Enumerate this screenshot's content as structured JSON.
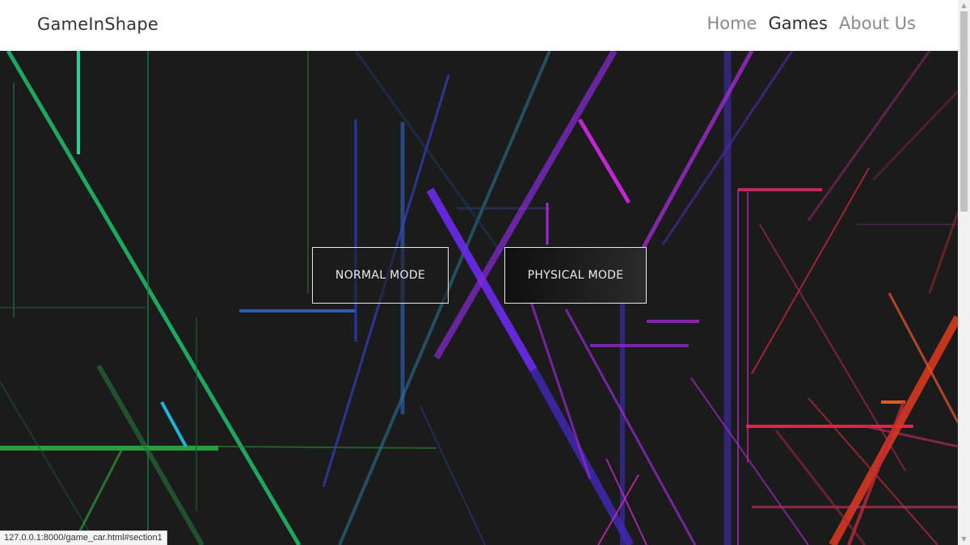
{
  "navbar": {
    "brand": "GameInShape",
    "links": [
      {
        "label": "Home",
        "active": false
      },
      {
        "label": "Games",
        "active": true
      },
      {
        "label": "About Us",
        "active": false
      }
    ]
  },
  "hero": {
    "buttons": [
      {
        "label": "NORMAL MODE"
      },
      {
        "label": "PHYSICAL MODE"
      }
    ],
    "background_color": "#1b1b1b",
    "line_palette": [
      "#1ec87a",
      "#2f9a3c",
      "#2a6cd4",
      "#5a2ee8",
      "#9b2bd9",
      "#d22ab8",
      "#e0324a",
      "#ef5a1e"
    ]
  },
  "status_bar": {
    "url": "127.0.0.1:8000/game_car.html#section1"
  }
}
